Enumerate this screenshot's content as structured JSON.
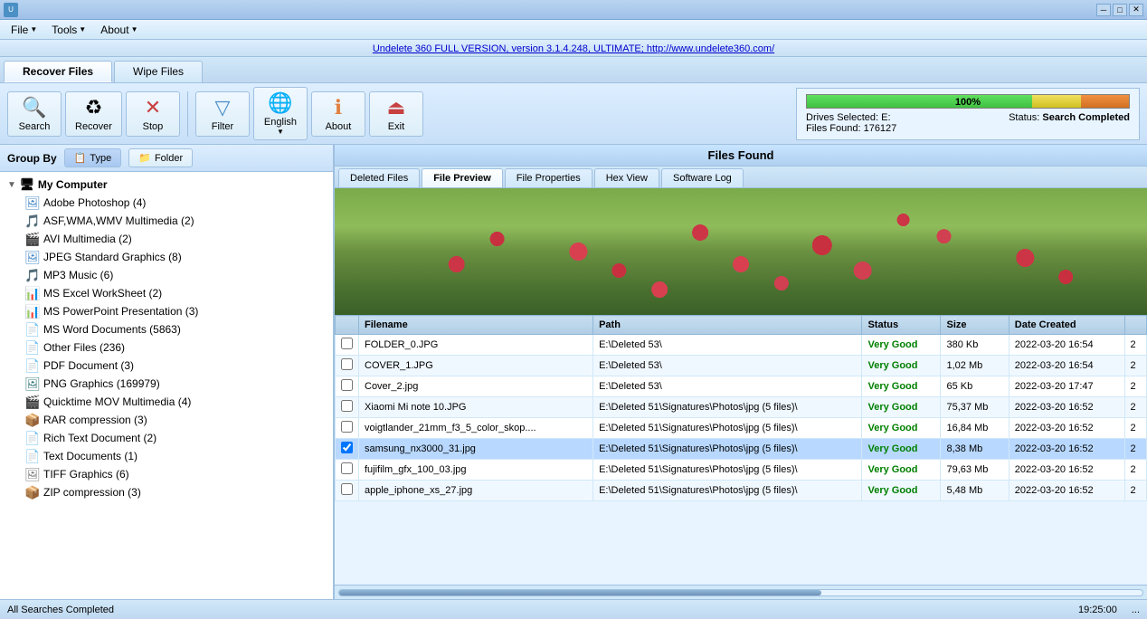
{
  "titlebar": {
    "minimize_label": "─",
    "maximize_label": "□",
    "close_label": "✕"
  },
  "menubar": {
    "file_label": "File",
    "tools_label": "Tools",
    "about_label": "About"
  },
  "linkbar": {
    "link_text": "Undelete 360 FULL VERSION, version 3.1.4.248, ULTIMATE; http://www.undelete360.com/"
  },
  "main_tabs": {
    "recover_files_label": "Recover Files",
    "wipe_files_label": "Wipe Files"
  },
  "toolbar": {
    "search_label": "Search",
    "recover_label": "Recover",
    "stop_label": "Stop",
    "filter_label": "Filter",
    "language_label": "English",
    "about_label": "About",
    "exit_label": "Exit"
  },
  "status_panel": {
    "progress_percent": "100%",
    "drives_selected": "Drives Selected: E:",
    "files_found_count": "Files Found: 176127",
    "status_label": "Status:",
    "status_value": "Search Completed",
    "progress_green_width": "70%",
    "progress_yellow_width": "15%",
    "progress_orange_width": "15%",
    "progress_yellow_left": "70%",
    "progress_orange_left": "85%"
  },
  "group_by": {
    "label": "Group By",
    "type_label": "Type",
    "folder_label": "Folder"
  },
  "tree": {
    "root_label": "My Computer",
    "items": [
      {
        "label": "Adobe Photoshop (4)",
        "icon": "🖼",
        "color": "blue"
      },
      {
        "label": "ASF,WMA,WMV Multimedia (2)",
        "icon": "🎵",
        "color": "orange"
      },
      {
        "label": "AVI Multimedia (2)",
        "icon": "🎬",
        "color": "orange"
      },
      {
        "label": "JPEG Standard Graphics (8)",
        "icon": "🖼",
        "color": "blue"
      },
      {
        "label": "MP3 Music (6)",
        "icon": "♪",
        "color": "green"
      },
      {
        "label": "MS Excel WorkSheet (2)",
        "icon": "📊",
        "color": "green"
      },
      {
        "label": "MS PowerPoint Presentation (3)",
        "icon": "📊",
        "color": "orange"
      },
      {
        "label": "MS Word Documents (5863)",
        "icon": "📄",
        "color": "blue"
      },
      {
        "label": "Other Files (236)",
        "icon": "📄",
        "color": "gray"
      },
      {
        "label": "PDF Document (3)",
        "icon": "📄",
        "color": "red"
      },
      {
        "label": "PNG Graphics (169979)",
        "icon": "🖼",
        "color": "teal"
      },
      {
        "label": "Quicktime MOV Multimedia (4)",
        "icon": "🎬",
        "color": "gray"
      },
      {
        "label": "RAR compression (3)",
        "icon": "📦",
        "color": "purple"
      },
      {
        "label": "Rich Text Document (2)",
        "icon": "📄",
        "color": "blue"
      },
      {
        "label": "Text Documents (1)",
        "icon": "📄",
        "color": "gray"
      },
      {
        "label": "TIFF Graphics (6)",
        "icon": "🖼",
        "color": "gray"
      },
      {
        "label": "ZIP compression (3)",
        "icon": "📦",
        "color": "yellow"
      }
    ]
  },
  "files_found": {
    "header": "Files Found",
    "tabs": [
      {
        "label": "Deleted Files"
      },
      {
        "label": "File Preview"
      },
      {
        "label": "File Properties"
      },
      {
        "label": "Hex View"
      },
      {
        "label": "Software Log"
      }
    ],
    "columns": [
      "",
      "Filename",
      "Path",
      "Status",
      "Size",
      "Date Created",
      ""
    ],
    "rows": [
      {
        "checked": false,
        "filename": "FOLDER_0.JPG",
        "path": "E:\\Deleted 53\\",
        "status": "Very Good",
        "size": "380 Kb",
        "date": "2022-03-20 16:54",
        "extra": "2"
      },
      {
        "checked": false,
        "filename": "COVER_1.JPG",
        "path": "E:\\Deleted 53\\",
        "status": "Very Good",
        "size": "1,02 Mb",
        "date": "2022-03-20 16:54",
        "extra": "2"
      },
      {
        "checked": false,
        "filename": "Cover_2.jpg",
        "path": "E:\\Deleted 53\\",
        "status": "Very Good",
        "size": "65 Kb",
        "date": "2022-03-20 17:47",
        "extra": "2"
      },
      {
        "checked": false,
        "filename": "Xiaomi Mi note 10.JPG",
        "path": "E:\\Deleted 51\\Signatures\\Photos\\jpg (5 files)\\",
        "status": "Very Good",
        "size": "75,37 Mb",
        "date": "2022-03-20 16:52",
        "extra": "2"
      },
      {
        "checked": false,
        "filename": "voigtlander_21mm_f3_5_color_skop....",
        "path": "E:\\Deleted 51\\Signatures\\Photos\\jpg (5 files)\\",
        "status": "Very Good",
        "size": "16,84 Mb",
        "date": "2022-03-20 16:52",
        "extra": "2"
      },
      {
        "checked": true,
        "filename": "samsung_nx3000_31.jpg",
        "path": "E:\\Deleted 51\\Signatures\\Photos\\jpg (5 files)\\",
        "status": "Very Good",
        "size": "8,38 Mb",
        "date": "2022-03-20 16:52",
        "extra": "2"
      },
      {
        "checked": false,
        "filename": "fujifilm_gfx_100_03.jpg",
        "path": "E:\\Deleted 51\\Signatures\\Photos\\jpg (5 files)\\",
        "status": "Very Good",
        "size": "79,63 Mb",
        "date": "2022-03-20 16:52",
        "extra": "2"
      },
      {
        "checked": false,
        "filename": "apple_iphone_xs_27.jpg",
        "path": "E:\\Deleted 51\\Signatures\\Photos\\jpg (5 files)\\",
        "status": "Very Good",
        "size": "5,48 Mb",
        "date": "2022-03-20 16:52",
        "extra": "2"
      }
    ]
  },
  "statusbar": {
    "left_text": "All Searches Completed",
    "time_text": "19:25:00",
    "indicator": "..."
  }
}
